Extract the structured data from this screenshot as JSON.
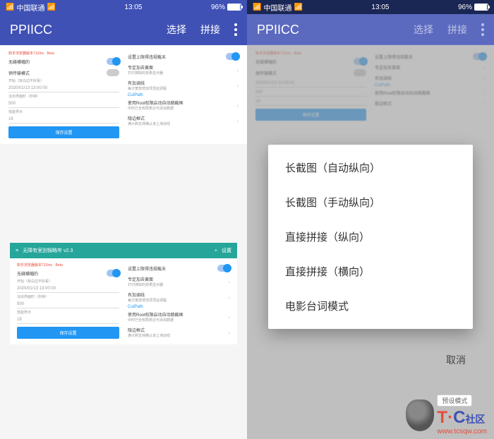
{
  "status": {
    "carrier": "中国联通",
    "time": "13:05",
    "battery_pct": "96%"
  },
  "appbar": {
    "title": "PPIICC",
    "action_select": "选择",
    "action_splice": "拼接"
  },
  "settings": {
    "left_col": {
      "header_red": "知乎浏览器版本712ms · Beta",
      "item1": "无缝横幅的",
      "item2": "销传输模式",
      "item3_label": "开始（有白边不好看）",
      "item3_val": "2020/01/13 13:00:00",
      "item4_label": "淡出界面时（秒钟）",
      "item4_val": "500",
      "item5_label": "低能界示",
      "item5_val": "18",
      "btn": "保存设置"
    },
    "right_col": {
      "item1": "设置上限得违规截末",
      "item2_title": "专定加去黄面",
      "item2_sub": "打印搜取的效果显示器",
      "item3_title": "有加调线",
      "item3_sub": "每次宽放增加顶顶运调程",
      "item4_link": "CutPath",
      "item5_title": "使用Root权限启动自动跳截框",
      "item5_sub": "中时已全权限表达可添加数据",
      "item6_title": "隐边框式",
      "item6_sub": "满计刷支持确认该上滑动线"
    }
  },
  "bottom_panel": {
    "header_back": "≡",
    "header_title": "无障有室刮锦略年 v2.3",
    "header_plus": "+",
    "header_set": "设置"
  },
  "menu": {
    "items": [
      "长截图（自动纵向）",
      "长截图（手动纵向）",
      "直接拼接（纵向）",
      "直接拼接（横向）",
      "电影台词模式"
    ],
    "cancel": "取消"
  },
  "watermark": {
    "badge": "预设模式",
    "logo_t": "T",
    "logo_c": "C",
    "logo_suffix": "社区",
    "url": "www.tcsqw.com"
  }
}
